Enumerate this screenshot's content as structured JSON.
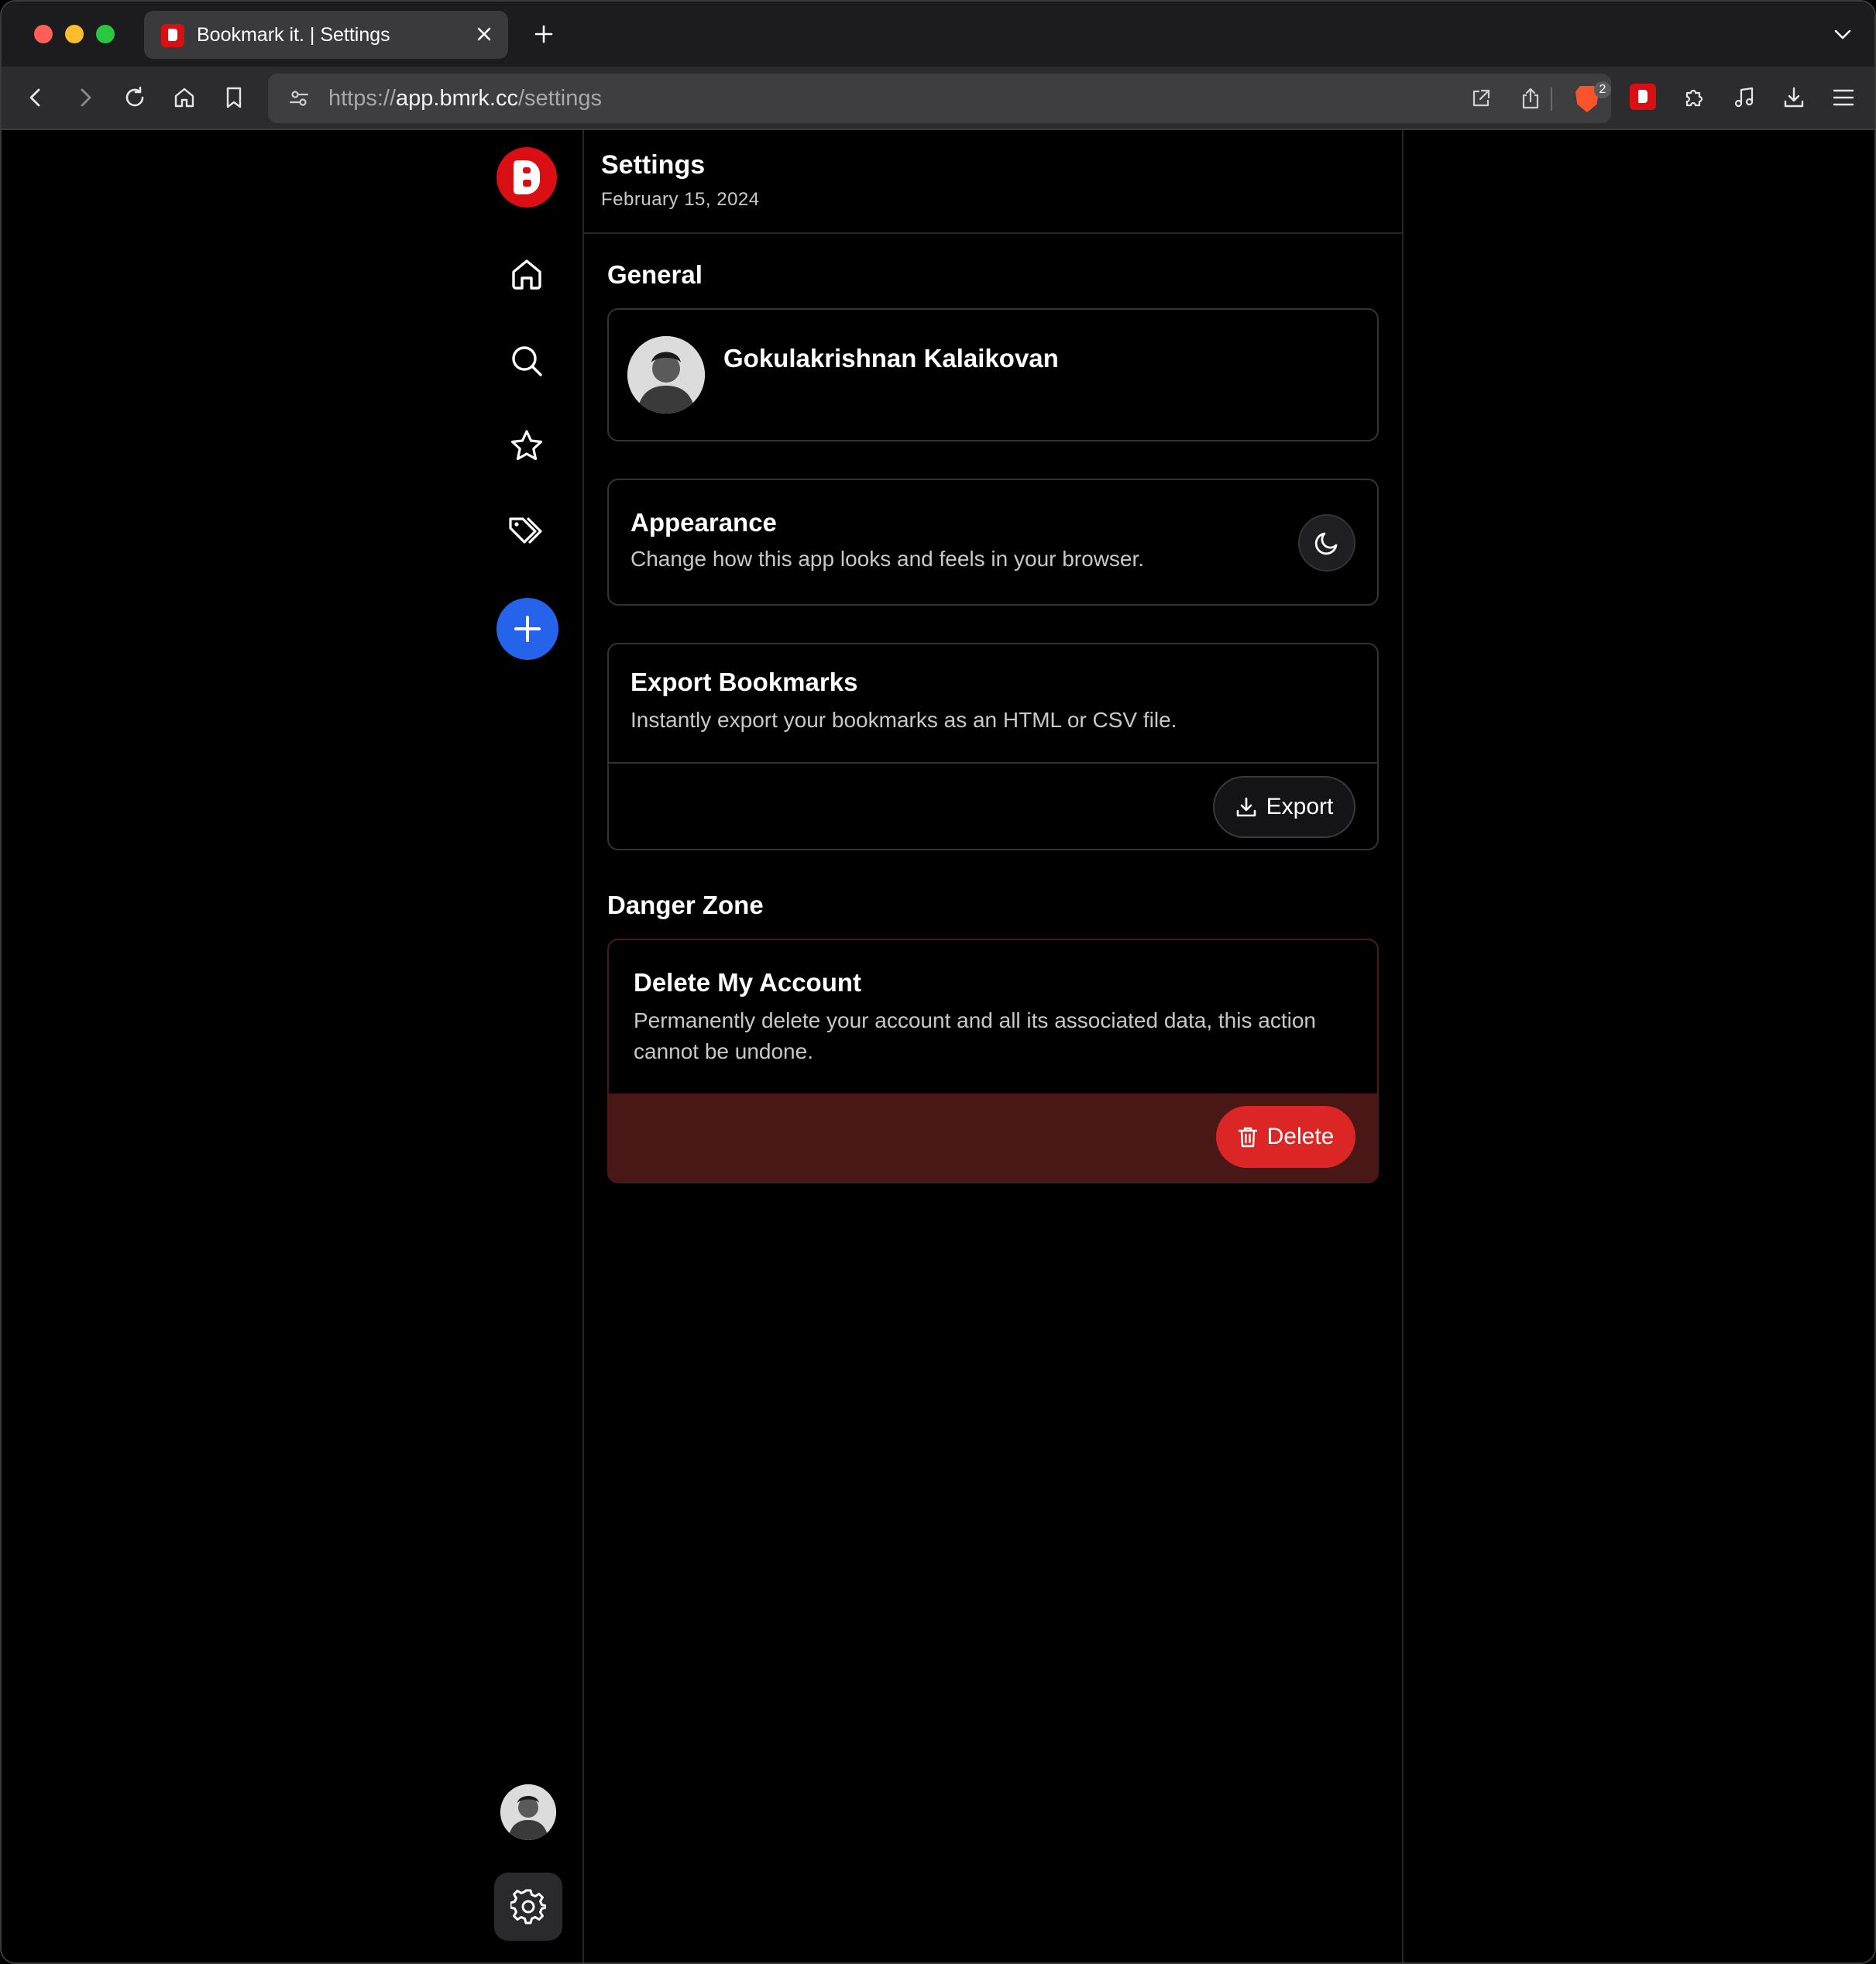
{
  "browser": {
    "tab_title": "Bookmark it. | Settings",
    "url_scheme": "https://",
    "url_host": "app.bmrk.cc",
    "url_path": "/settings",
    "shields_badge": "2",
    "brand_color": "#fb542b"
  },
  "app": {
    "brand_color": "#d90f13",
    "accent_color": "#2563eb",
    "danger_color": "#dc2626",
    "nav": [
      "home-icon",
      "search-icon",
      "star-icon",
      "tags-icon",
      "plus-icon"
    ]
  },
  "header": {
    "title": "Settings",
    "date": "February 15, 2024"
  },
  "general": {
    "section_title": "General",
    "profile": {
      "name": "Gokulakrishnan Kalaikovan",
      "email": ""
    },
    "appearance": {
      "title": "Appearance",
      "description": "Change how this app looks and feels in your browser.",
      "toggle_icon": "moon-icon"
    },
    "export": {
      "title": "Export Bookmarks",
      "description": "Instantly export your bookmarks as an HTML or CSV file.",
      "button_label": "Export"
    }
  },
  "danger": {
    "section_title": "Danger Zone",
    "title": "Delete My Account",
    "description": "Permanently delete your account and all its associated data, this action cannot be undone.",
    "button_label": "Delete"
  }
}
